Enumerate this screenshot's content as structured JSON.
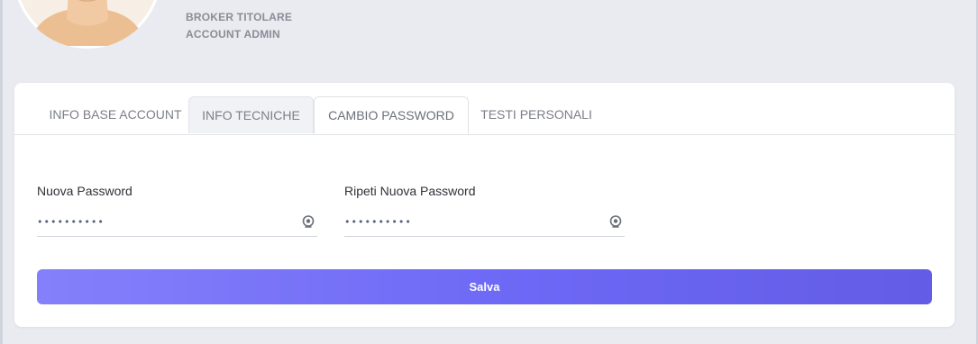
{
  "profile": {
    "role_line_1": "BROKER TITOLARE",
    "role_line_2": "ACCOUNT ADMIN"
  },
  "tabs": [
    {
      "label": "INFO BASE ACCOUNT",
      "state": "default"
    },
    {
      "label": "INFO TECNICHE",
      "state": "inactive-boxed"
    },
    {
      "label": "CAMBIO PASSWORD",
      "state": "active"
    },
    {
      "label": "TESTI PERSONALI",
      "state": "default"
    }
  ],
  "form": {
    "new_password": {
      "label": "Nuova Password",
      "value": "••••••••••",
      "icon": "eye-icon"
    },
    "repeat_password": {
      "label": "Ripeti Nuova Password",
      "value": "••••••••••",
      "icon": "eye-icon"
    },
    "save_label": "Salva"
  },
  "colors": {
    "page_background": "#e9ebf0",
    "card_background": "#ffffff",
    "button_gradient_start": "#8480fb",
    "button_gradient_end": "#625ce6",
    "avatar_skin": "#f1c9a2"
  }
}
